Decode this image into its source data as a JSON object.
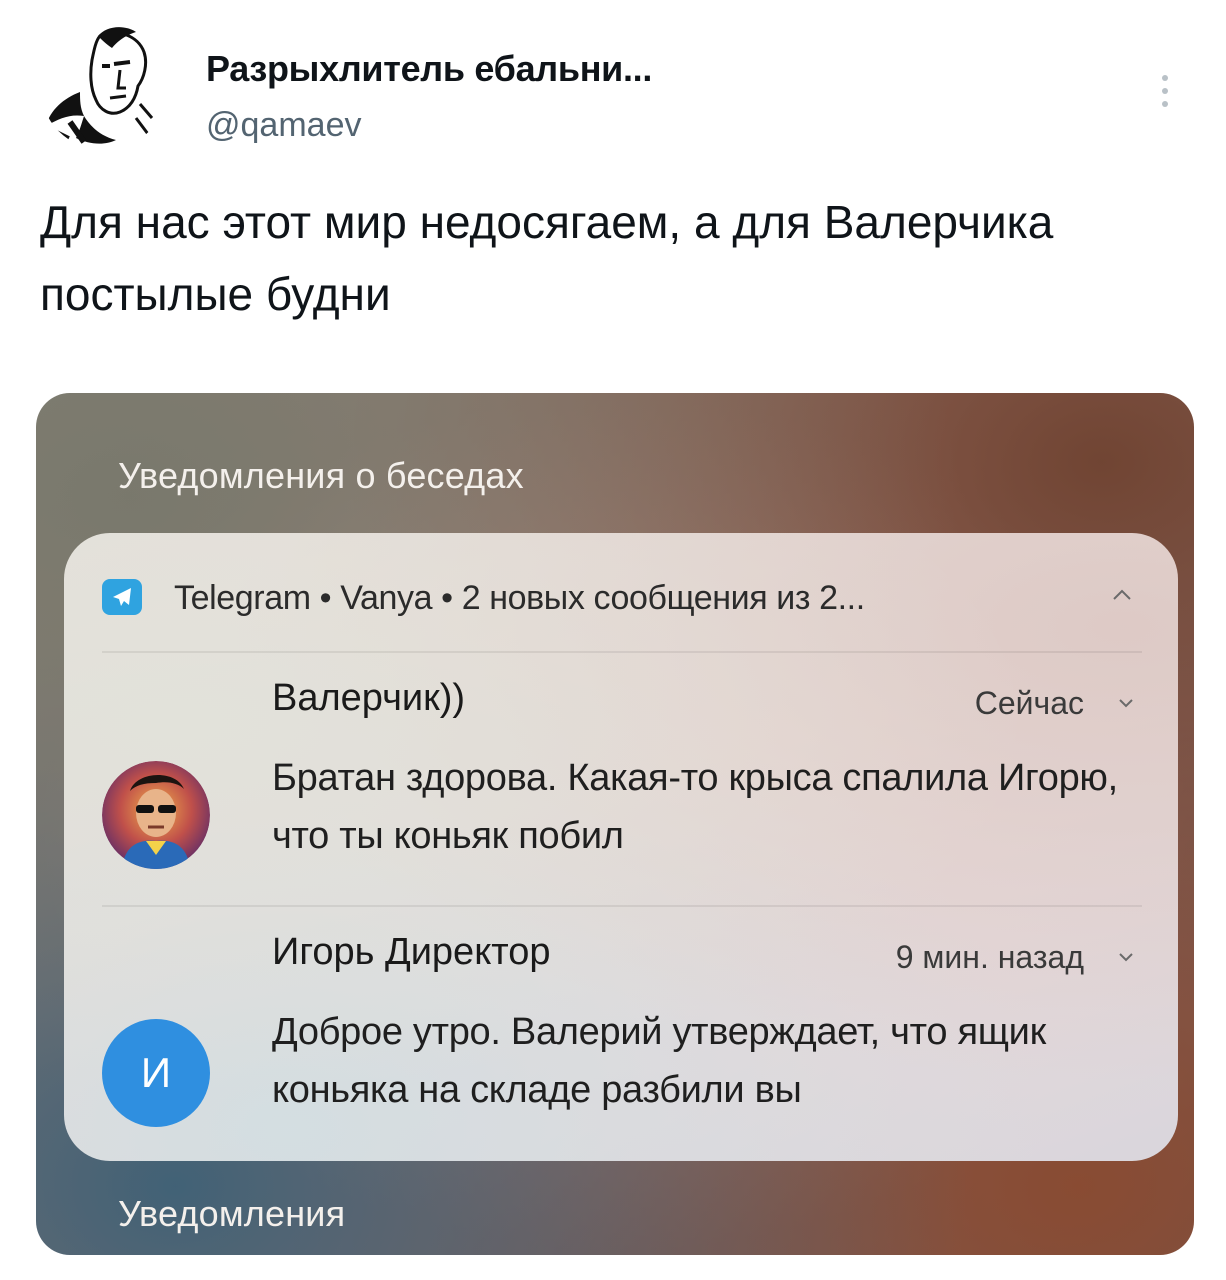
{
  "tweet": {
    "author_name": "Разрыхлитель ебальни...",
    "author_handle": "@qamaev",
    "text": "Для нас этот мир недосягаем, а для Валерчика постылые будни"
  },
  "screenshot": {
    "section_title": "Уведомления о беседах",
    "bottom_section_title": "Уведомления",
    "notification": {
      "app_summary": "Telegram • Vanya  •  2 новых сообщения из 2...",
      "messages": [
        {
          "sender": "Валерчик))",
          "time": "Сейчас",
          "text": "Братан здорова. Какая-то крыса спалила Игорю, что ты коньяк побил"
        },
        {
          "sender": "Игорь Директор",
          "time": "9 мин. назад",
          "avatar_letter": "И",
          "text": "Доброе утро. Валерий утверждает, что ящик коньяка на складе разбили вы"
        }
      ]
    }
  },
  "colors": {
    "telegram_blue": "#2fa3e0",
    "letter_avatar": "#2f8fe0",
    "handle_gray": "#536471"
  },
  "icons": [
    "more-dots-icon",
    "telegram-icon",
    "chevron-up-icon",
    "chevron-down-icon"
  ]
}
